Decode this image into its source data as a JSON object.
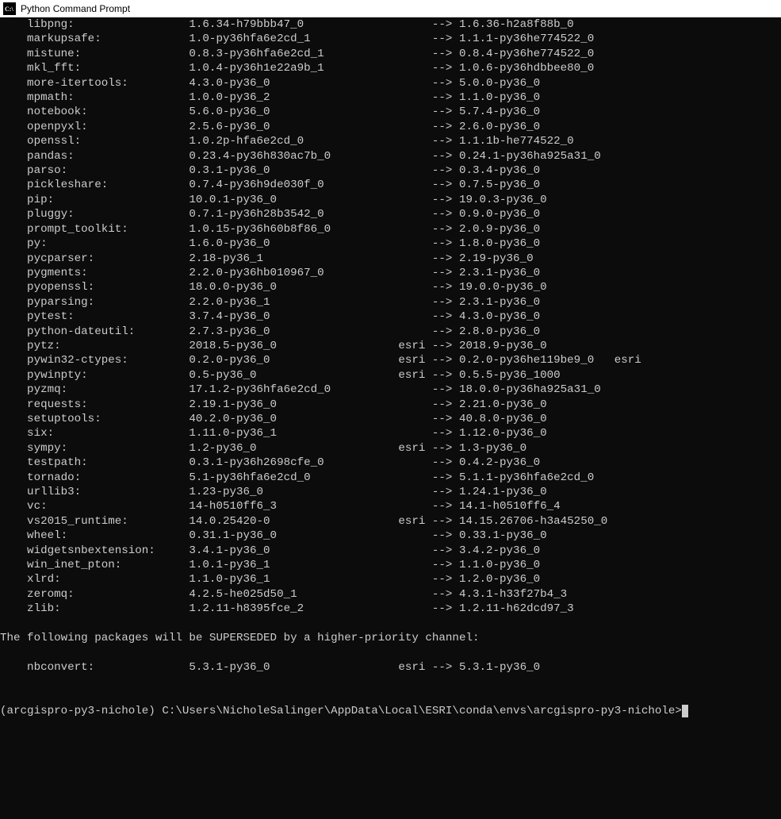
{
  "window": {
    "title": "Python Command Prompt"
  },
  "packages": [
    {
      "name": "libpng:",
      "from": "1.6.34-h79bbb47_0",
      "channel": "",
      "to": "1.6.36-h2a8f88b_0",
      "tail": ""
    },
    {
      "name": "markupsafe:",
      "from": "1.0-py36hfa6e2cd_1",
      "channel": "",
      "to": "1.1.1-py36he774522_0",
      "tail": ""
    },
    {
      "name": "mistune:",
      "from": "0.8.3-py36hfa6e2cd_1",
      "channel": "",
      "to": "0.8.4-py36he774522_0",
      "tail": ""
    },
    {
      "name": "mkl_fft:",
      "from": "1.0.4-py36h1e22a9b_1",
      "channel": "",
      "to": "1.0.6-py36hdbbee80_0",
      "tail": ""
    },
    {
      "name": "more-itertools:",
      "from": "4.3.0-py36_0",
      "channel": "",
      "to": "5.0.0-py36_0",
      "tail": ""
    },
    {
      "name": "mpmath:",
      "from": "1.0.0-py36_2",
      "channel": "",
      "to": "1.1.0-py36_0",
      "tail": ""
    },
    {
      "name": "notebook:",
      "from": "5.6.0-py36_0",
      "channel": "",
      "to": "5.7.4-py36_0",
      "tail": ""
    },
    {
      "name": "openpyxl:",
      "from": "2.5.6-py36_0",
      "channel": "",
      "to": "2.6.0-py36_0",
      "tail": ""
    },
    {
      "name": "openssl:",
      "from": "1.0.2p-hfa6e2cd_0",
      "channel": "",
      "to": "1.1.1b-he774522_0",
      "tail": ""
    },
    {
      "name": "pandas:",
      "from": "0.23.4-py36h830ac7b_0",
      "channel": "",
      "to": "0.24.1-py36ha925a31_0",
      "tail": ""
    },
    {
      "name": "parso:",
      "from": "0.3.1-py36_0",
      "channel": "",
      "to": "0.3.4-py36_0",
      "tail": ""
    },
    {
      "name": "pickleshare:",
      "from": "0.7.4-py36h9de030f_0",
      "channel": "",
      "to": "0.7.5-py36_0",
      "tail": ""
    },
    {
      "name": "pip:",
      "from": "10.0.1-py36_0",
      "channel": "",
      "to": "19.0.3-py36_0",
      "tail": ""
    },
    {
      "name": "pluggy:",
      "from": "0.7.1-py36h28b3542_0",
      "channel": "",
      "to": "0.9.0-py36_0",
      "tail": ""
    },
    {
      "name": "prompt_toolkit:",
      "from": "1.0.15-py36h60b8f86_0",
      "channel": "",
      "to": "2.0.9-py36_0",
      "tail": ""
    },
    {
      "name": "py:",
      "from": "1.6.0-py36_0",
      "channel": "",
      "to": "1.8.0-py36_0",
      "tail": ""
    },
    {
      "name": "pycparser:",
      "from": "2.18-py36_1",
      "channel": "",
      "to": "2.19-py36_0",
      "tail": ""
    },
    {
      "name": "pygments:",
      "from": "2.2.0-py36hb010967_0",
      "channel": "",
      "to": "2.3.1-py36_0",
      "tail": ""
    },
    {
      "name": "pyopenssl:",
      "from": "18.0.0-py36_0",
      "channel": "",
      "to": "19.0.0-py36_0",
      "tail": ""
    },
    {
      "name": "pyparsing:",
      "from": "2.2.0-py36_1",
      "channel": "",
      "to": "2.3.1-py36_0",
      "tail": ""
    },
    {
      "name": "pytest:",
      "from": "3.7.4-py36_0",
      "channel": "",
      "to": "4.3.0-py36_0",
      "tail": ""
    },
    {
      "name": "python-dateutil:",
      "from": "2.7.3-py36_0",
      "channel": "",
      "to": "2.8.0-py36_0",
      "tail": ""
    },
    {
      "name": "pytz:",
      "from": "2018.5-py36_0",
      "channel": "esri",
      "to": "2018.9-py36_0",
      "tail": ""
    },
    {
      "name": "pywin32-ctypes:",
      "from": "0.2.0-py36_0",
      "channel": "esri",
      "to": "0.2.0-py36he119be9_0",
      "tail": "   esri"
    },
    {
      "name": "pywinpty:",
      "from": "0.5-py36_0",
      "channel": "esri",
      "to": "0.5.5-py36_1000",
      "tail": ""
    },
    {
      "name": "pyzmq:",
      "from": "17.1.2-py36hfa6e2cd_0",
      "channel": "",
      "to": "18.0.0-py36ha925a31_0",
      "tail": ""
    },
    {
      "name": "requests:",
      "from": "2.19.1-py36_0",
      "channel": "",
      "to": "2.21.0-py36_0",
      "tail": ""
    },
    {
      "name": "setuptools:",
      "from": "40.2.0-py36_0",
      "channel": "",
      "to": "40.8.0-py36_0",
      "tail": ""
    },
    {
      "name": "six:",
      "from": "1.11.0-py36_1",
      "channel": "",
      "to": "1.12.0-py36_0",
      "tail": ""
    },
    {
      "name": "sympy:",
      "from": "1.2-py36_0",
      "channel": "esri",
      "to": "1.3-py36_0",
      "tail": ""
    },
    {
      "name": "testpath:",
      "from": "0.3.1-py36h2698cfe_0",
      "channel": "",
      "to": "0.4.2-py36_0",
      "tail": ""
    },
    {
      "name": "tornado:",
      "from": "5.1-py36hfa6e2cd_0",
      "channel": "",
      "to": "5.1.1-py36hfa6e2cd_0",
      "tail": ""
    },
    {
      "name": "urllib3:",
      "from": "1.23-py36_0",
      "channel": "",
      "to": "1.24.1-py36_0",
      "tail": ""
    },
    {
      "name": "vc:",
      "from": "14-h0510ff6_3",
      "channel": "",
      "to": "14.1-h0510ff6_4",
      "tail": ""
    },
    {
      "name": "vs2015_runtime:",
      "from": "14.0.25420-0",
      "channel": "esri",
      "to": "14.15.26706-h3a45250_0",
      "tail": ""
    },
    {
      "name": "wheel:",
      "from": "0.31.1-py36_0",
      "channel": "",
      "to": "0.33.1-py36_0",
      "tail": ""
    },
    {
      "name": "widgetsnbextension:",
      "from": "3.4.1-py36_0",
      "channel": "",
      "to": "3.4.2-py36_0",
      "tail": ""
    },
    {
      "name": "win_inet_pton:",
      "from": "1.0.1-py36_1",
      "channel": "",
      "to": "1.1.0-py36_0",
      "tail": ""
    },
    {
      "name": "xlrd:",
      "from": "1.1.0-py36_1",
      "channel": "",
      "to": "1.2.0-py36_0",
      "tail": ""
    },
    {
      "name": "zeromq:",
      "from": "4.2.5-he025d50_1",
      "channel": "",
      "to": "4.3.1-h33f27b4_3",
      "tail": ""
    },
    {
      "name": "zlib:",
      "from": "1.2.11-h8395fce_2",
      "channel": "",
      "to": "1.2.11-h62dcd97_3",
      "tail": ""
    }
  ],
  "message": "The following packages will be SUPERSEDED by a higher-priority channel:",
  "superseded": [
    {
      "name": "nbconvert:",
      "from": "5.3.1-py36_0",
      "channel": "esri",
      "to": "5.3.1-py36_0",
      "tail": ""
    }
  ],
  "prompt": "(arcgispro-py3-nichole) C:\\Users\\NicholeSalinger\\AppData\\Local\\ESRI\\conda\\envs\\arcgispro-py3-nichole>",
  "cols": {
    "indent": 4,
    "name_w": 24,
    "from_w": 30,
    "chan_w": 5
  }
}
